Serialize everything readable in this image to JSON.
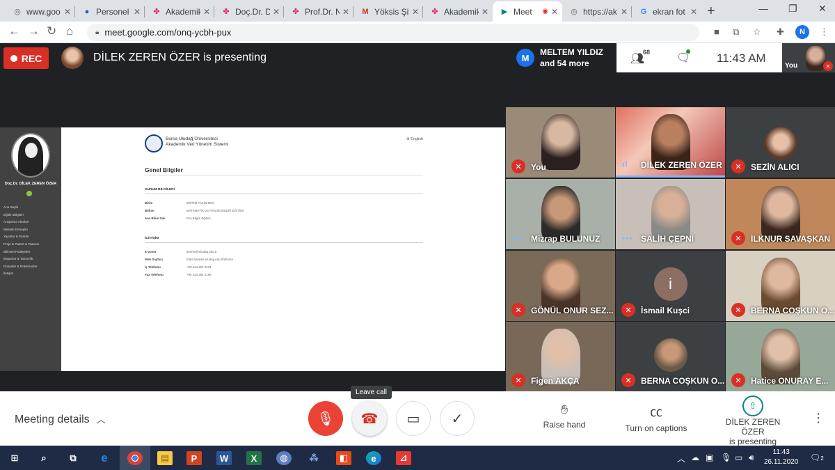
{
  "browser": {
    "tabs": [
      {
        "title": "www.goo",
        "icon": "globe-icon"
      },
      {
        "title": "Personel",
        "icon": "globe-icon"
      },
      {
        "title": "Akademik",
        "icon": "avesis-icon"
      },
      {
        "title": "Doç.Dr. D",
        "icon": "avesis-icon"
      },
      {
        "title": "Prof.Dr. N",
        "icon": "avesis-icon"
      },
      {
        "title": "Yöksis Şif",
        "icon": "gmail-icon"
      },
      {
        "title": "Akademik",
        "icon": "avesis-icon"
      },
      {
        "title": "Meet",
        "icon": "meet-icon",
        "active": true
      },
      {
        "title": "https://ak",
        "icon": "globe-icon"
      },
      {
        "title": "ekran fot",
        "icon": "google-icon"
      }
    ],
    "url": "meet.google.com/onq-ycbh-pux",
    "profile_initial": "N"
  },
  "meet": {
    "rec_label": "REC",
    "presenting_text": "DİLEK ZEREN ÖZER is presenting",
    "info_initial": "M",
    "info_line1": "MELTEM YILDIZ",
    "info_line2": "and 54 more",
    "participant_count": "68",
    "time": "11:43 AM",
    "self_label": "You"
  },
  "shared_screen": {
    "sidebar_name": "Doç.Dr. DİLEK ZEREN ÖZER",
    "menu": [
      "Ana Sayfa",
      "Eğitim Bilgileri",
      "Araştırma Alanları",
      "Mesleki Deneyim",
      "Yayınlar & Eserler",
      "Proje & Patent & Tasarım",
      "Bilimsel Faaliyetler",
      "Başarılar & Tanınırlık",
      "Dosyalar & Dokümanlar",
      "İletişim"
    ],
    "uni_line1": "Bursa Uludağ Üniversitesi",
    "uni_line2": "Akademik Veri Yönetim Sistemi",
    "lang": "⊕ English",
    "heading": "Genel Bilgiler",
    "section1": "KURUM BİLGİLERİ",
    "rows1": [
      {
        "k": "Birim",
        "v": "EĞİTİM FAKÜLTESİ"
      },
      {
        "k": "Bölüm",
        "v": "MATEMATİK VE FEN BİLİMLERİ EĞİTİMİ"
      },
      {
        "k": "Ana Bilim Dalı",
        "v": "Fen Bilgisi Eğitimi"
      }
    ],
    "section2": "İLETİŞİM",
    "rows2": [
      {
        "k": "E-posta",
        "v": "dzeren@uludag.edu.tr"
      },
      {
        "k": "Web Sayfası",
        "v": "https://avesis.uludag.edu.tr/dzeren"
      },
      {
        "k": "İş Telefonu",
        "v": "+90 224 294 2234"
      },
      {
        "k": "Fax Telefonu",
        "v": "+90 224 294 2199"
      }
    ]
  },
  "tiles": [
    {
      "name": "You",
      "state": "muted"
    },
    {
      "name": "DİLEK ZEREN ÖZER",
      "state": "speaking"
    },
    {
      "name": "SEZİN ALICI",
      "state": "muted"
    },
    {
      "name": "Mizrap BULUNUZ",
      "state": "dots"
    },
    {
      "name": "SALİH ÇEPNİ",
      "state": "dots"
    },
    {
      "name": "İLKNUR SAVAŞKAN",
      "state": "muted"
    },
    {
      "name": "GÖNÜL ONUR SEZ...",
      "state": "muted"
    },
    {
      "name": "İsmail Kuşci",
      "state": "muted",
      "avatar": "i"
    },
    {
      "name": "BERNA COŞKUN O...",
      "state": "muted"
    },
    {
      "name": "Figen AKÇA",
      "state": "muted"
    },
    {
      "name": "BERNA COŞKUN O...",
      "state": "muted"
    },
    {
      "name": "Hatice ONURAY E...",
      "state": "muted"
    }
  ],
  "controls": {
    "meeting_details": "Meeting details",
    "leave_tooltip": "Leave call",
    "raise_hand": "Raise hand",
    "captions": "Turn on captions",
    "presenting_line1": "DİLEK ZEREN ÖZER",
    "presenting_line2": "is presenting"
  },
  "taskbar": {
    "time": "11:43",
    "date": "26.11.2020",
    "notifications": "2"
  },
  "colors": {
    "accent": "#1a73e8",
    "danger": "#ea4335",
    "meet_bg": "#202124",
    "taskbar": "#1f2a44"
  }
}
